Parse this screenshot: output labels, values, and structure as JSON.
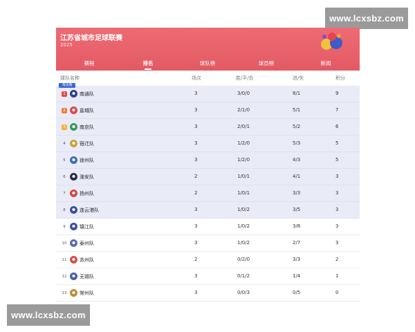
{
  "watermarks": {
    "top": "www.lcxsbz.com",
    "bottom": "www.lcxsbz.com"
  },
  "header": {
    "title": "江苏省城市足球联赛",
    "subtitle": "2025",
    "logo_icon": "league-logo-icon"
  },
  "tabs": [
    {
      "label": "赛程",
      "active": false
    },
    {
      "label": "排名",
      "active": true
    },
    {
      "label": "球队榜",
      "active": false
    },
    {
      "label": "球员榜",
      "active": false
    },
    {
      "label": "新闻",
      "active": false
    }
  ],
  "table": {
    "columns": {
      "team": "球队名称",
      "played": "场次",
      "wdl": "胜/平/负",
      "goals": "进/失",
      "points": "积分"
    },
    "promotion_label": "淘汰赛",
    "rows": [
      {
        "rank": "1",
        "name": "南通队",
        "played": "3",
        "wdl": "3/0/0",
        "goals": "8/1",
        "points": "9",
        "qualified": true,
        "badge_color": "#e14b4b",
        "icon_color": "#2f3f8f"
      },
      {
        "rank": "2",
        "name": "盐城队",
        "played": "3",
        "wdl": "2/1/0",
        "goals": "5/1",
        "points": "7",
        "qualified": true,
        "badge_color": "#f07f35",
        "icon_color": "#d94b4b"
      },
      {
        "rank": "3",
        "name": "南京队",
        "played": "3",
        "wdl": "2/0/1",
        "goals": "5/2",
        "points": "6",
        "qualified": true,
        "badge_color": "#f2b23a",
        "icon_color": "#3b9a5a"
      },
      {
        "rank": "4",
        "name": "宿迁队",
        "played": "3",
        "wdl": "1/2/0",
        "goals": "5/3",
        "points": "5",
        "qualified": true,
        "badge_color": "",
        "icon_color": "#c9a23a"
      },
      {
        "rank": "5",
        "name": "徐州队",
        "played": "3",
        "wdl": "1/2/0",
        "goals": "4/3",
        "points": "5",
        "qualified": true,
        "badge_color": "",
        "icon_color": "#3c6fb5"
      },
      {
        "rank": "6",
        "name": "淮安队",
        "played": "2",
        "wdl": "1/0/1",
        "goals": "4/1",
        "points": "3",
        "qualified": true,
        "badge_color": "",
        "icon_color": "#2b2f45"
      },
      {
        "rank": "7",
        "name": "扬州队",
        "played": "2",
        "wdl": "1/0/1",
        "goals": "3/3",
        "points": "3",
        "qualified": true,
        "badge_color": "",
        "icon_color": "#d8473f"
      },
      {
        "rank": "8",
        "name": "连云港队",
        "played": "3",
        "wdl": "1/0/2",
        "goals": "3/5",
        "points": "3",
        "qualified": true,
        "badge_color": "",
        "icon_color": "#3a4fa0"
      },
      {
        "rank": "9",
        "name": "镇江队",
        "played": "3",
        "wdl": "1/0/2",
        "goals": "3/8",
        "points": "3",
        "qualified": false,
        "badge_color": "",
        "icon_color": "#3a4fa0"
      },
      {
        "rank": "10",
        "name": "泰州队",
        "played": "3",
        "wdl": "1/0/2",
        "goals": "2/7",
        "points": "3",
        "qualified": false,
        "badge_color": "",
        "icon_color": "#5a6fb0"
      },
      {
        "rank": "11",
        "name": "苏州队",
        "played": "2",
        "wdl": "0/2/0",
        "goals": "3/3",
        "points": "2",
        "qualified": false,
        "badge_color": "",
        "icon_color": "#d94b4b"
      },
      {
        "rank": "12",
        "name": "无锡队",
        "played": "3",
        "wdl": "0/1/2",
        "goals": "1/4",
        "points": "1",
        "qualified": false,
        "badge_color": "",
        "icon_color": "#4a5fb0"
      },
      {
        "rank": "13",
        "name": "常州队",
        "played": "3",
        "wdl": "0/0/3",
        "goals": "0/5",
        "points": "0",
        "qualified": false,
        "badge_color": "",
        "icon_color": "#c08a3a"
      }
    ]
  }
}
